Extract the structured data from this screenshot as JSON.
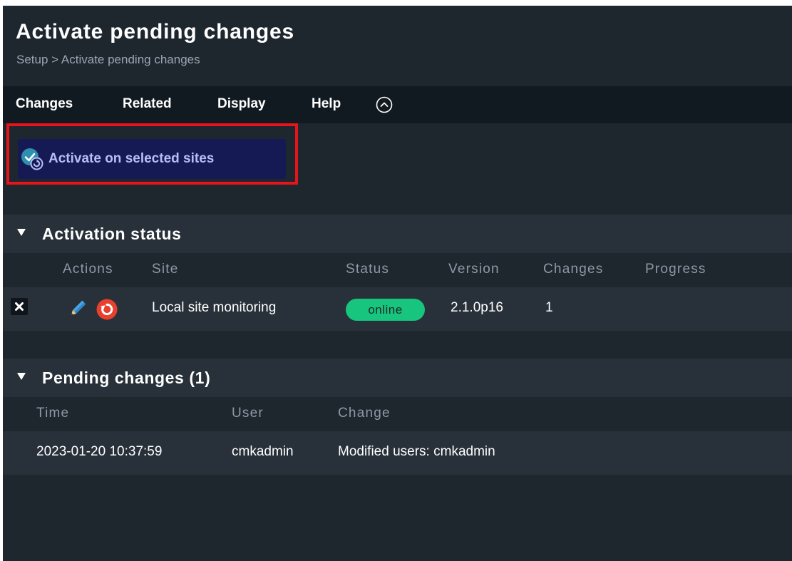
{
  "header": {
    "title": "Activate pending changes",
    "breadcrumb": {
      "parent": "Setup",
      "separator": ">",
      "current": "Activate pending changes"
    }
  },
  "menubar": {
    "items": [
      {
        "label": "Changes"
      },
      {
        "label": "Related"
      },
      {
        "label": "Display"
      },
      {
        "label": "Help"
      }
    ],
    "toggle_icon": "chevron-up-circle-icon"
  },
  "actions": {
    "activate_label": "Activate on selected sites",
    "activate_icon": "activate-check-icon"
  },
  "activation_status": {
    "title": "Activation status",
    "columns": [
      "Actions",
      "Site",
      "Status",
      "Version",
      "Changes",
      "Progress"
    ],
    "rows": [
      {
        "site": "Local site monitoring",
        "status": "online",
        "version": "2.1.0p16",
        "changes": "1",
        "progress": ""
      }
    ]
  },
  "pending_changes": {
    "title": "Pending changes (1)",
    "columns": [
      "Time",
      "User",
      "Change"
    ],
    "rows": [
      {
        "time": "2023-01-20 10:37:59",
        "user": "cmkadmin",
        "change": "Modified users: cmkadmin"
      }
    ]
  },
  "colors": {
    "background": "#1e262e",
    "menubar": "#121a21",
    "section": "#283139",
    "button": "#151a55",
    "button_text": "#b9bdf7",
    "highlight": "#e8141c",
    "online": "#17c57f",
    "restart": "#e8402e"
  }
}
